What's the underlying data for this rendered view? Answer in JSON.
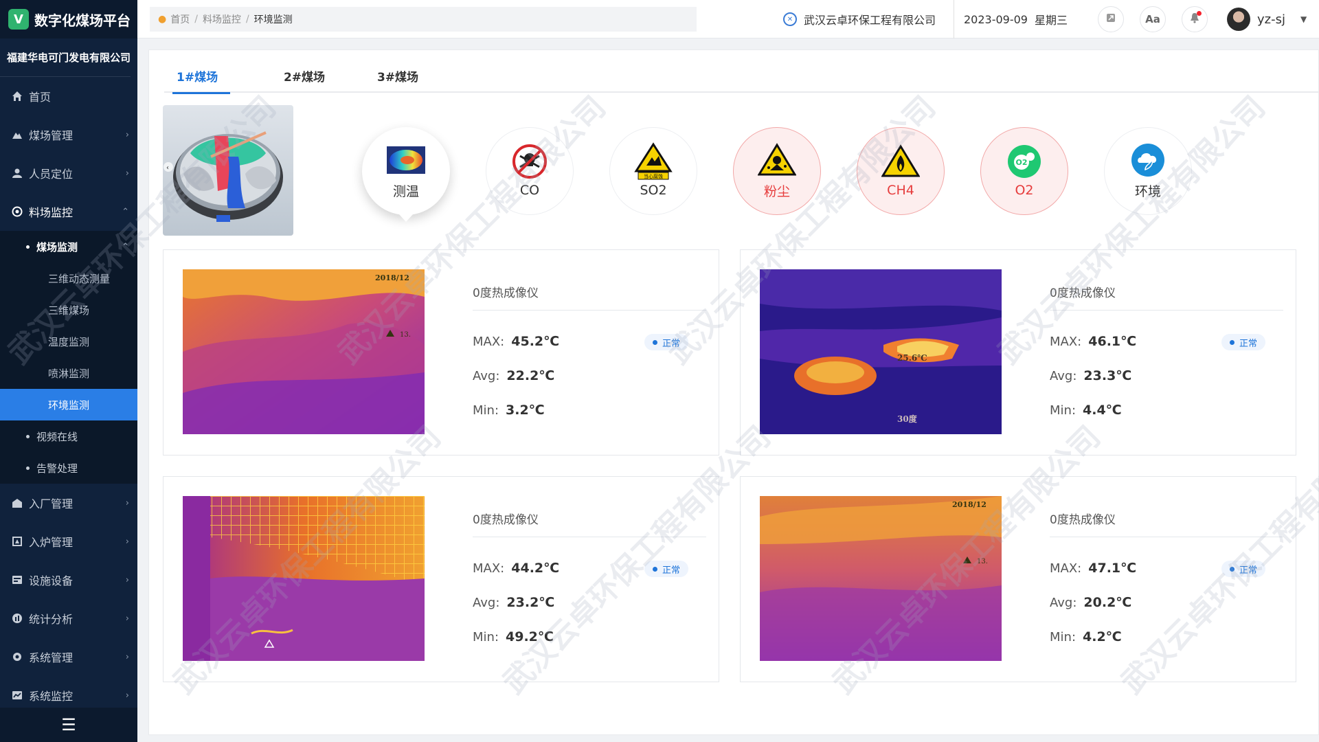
{
  "app": {
    "title": "数字化煤场平台",
    "logo_letter": "V"
  },
  "company": "福建华电可门发电有限公司",
  "sidebar": {
    "items": [
      {
        "label": "首页",
        "icon": "home-icon"
      },
      {
        "label": "煤场管理",
        "icon": "coal-yard-icon"
      },
      {
        "label": "人员定位",
        "icon": "person-icon"
      },
      {
        "label": "料场监控",
        "icon": "monitor-icon"
      },
      {
        "label": "入厂管理",
        "icon": "factory-icon"
      },
      {
        "label": "入炉管理",
        "icon": "furnace-icon"
      },
      {
        "label": "设施设备",
        "icon": "device-icon"
      },
      {
        "label": "统计分析",
        "icon": "stats-icon"
      },
      {
        "label": "系统管理",
        "icon": "settings-icon"
      },
      {
        "label": "系统监控",
        "icon": "system-monitor-icon"
      }
    ],
    "sub": {
      "group": "煤场监测",
      "children": [
        "三维动态测量",
        "三维煤场",
        "温度监测",
        "喷淋监测",
        "环境监测"
      ],
      "others": [
        "视频在线",
        "告警处理"
      ]
    },
    "collapse_icon": "menu-fold-icon"
  },
  "breadcrumb": {
    "items": [
      "首页",
      "料场监控",
      "环境监测"
    ]
  },
  "topbar": {
    "company": "武汉云卓环保工程有限公司",
    "date": "2023-09-09",
    "weekday": "星期三",
    "font_label": "Aa",
    "username": "yz-sj"
  },
  "tabs": [
    "1#煤场",
    "2#煤场",
    "3#煤场"
  ],
  "sensors": [
    {
      "label": "测温",
      "state": "selected"
    },
    {
      "label": "CO",
      "state": "normal"
    },
    {
      "label": "SO2",
      "state": "normal"
    },
    {
      "label": "粉尘",
      "state": "alarm"
    },
    {
      "label": "CH4",
      "state": "alarm"
    },
    {
      "label": "O2",
      "state": "alarm"
    },
    {
      "label": "环境",
      "state": "normal"
    }
  ],
  "sensor_icon_texts": {
    "so2": "当心腐蚀"
  },
  "cameras": [
    {
      "name": "0度热成像仪",
      "max": "45.2℃",
      "avg": "22.2℃",
      "min": "3.2℃",
      "status": "正常",
      "overlay": "2018/12",
      "mark": "13."
    },
    {
      "name": "0度热成像仪",
      "max": "46.1℃",
      "avg": "23.3℃",
      "min": "4.4℃",
      "status": "正常",
      "overlay": "30度",
      "mark": "25.6℃"
    },
    {
      "name": "0度热成像仪",
      "max": "44.2℃",
      "avg": "23.2℃",
      "min": "49.2℃",
      "status": "正常",
      "overlay": "",
      "mark": ""
    },
    {
      "name": "0度热成像仪",
      "max": "47.1℃",
      "avg": "20.2℃",
      "min": "4.2℃",
      "status": "正常",
      "overlay": "2018/12",
      "mark": "13."
    }
  ],
  "stat_labels": {
    "max": "MAX:",
    "avg": "Avg:",
    "min": "Min:"
  },
  "watermark": "武汉云卓环保工程有限公司",
  "colors": {
    "accent": "#1e74d9",
    "sidebar": "#10223c",
    "alarm": "#e63c3c"
  }
}
